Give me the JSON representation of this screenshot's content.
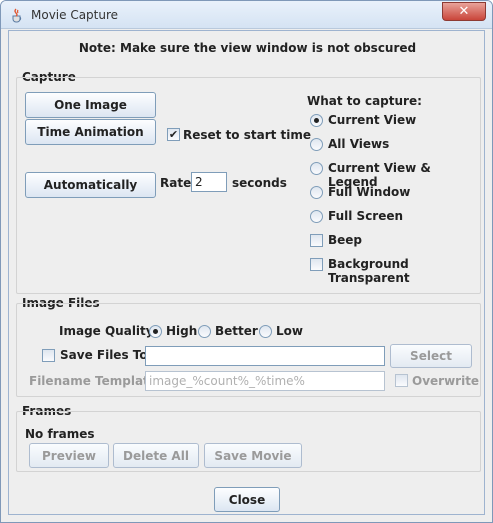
{
  "window": {
    "title": "Movie Capture",
    "close_glyph": "✕"
  },
  "note": "Note: Make sure the view window is not obscured",
  "capture": {
    "group_label": "Capture",
    "one_image": "One Image",
    "time_animation": "Time Animation",
    "reset_label": "Reset to start time",
    "reset_checked": "✔",
    "automatically": "Automatically",
    "rate_label": "Rate:",
    "rate_value": "2",
    "seconds_label": "seconds",
    "what_label": "What to capture:",
    "options": [
      "Current View",
      "All Views",
      "Current View & Legend",
      "Full Window",
      "Full Screen"
    ],
    "selected": "Current View",
    "beep_label": "Beep",
    "bg_transparent_label": "Background Transparent"
  },
  "image_files": {
    "group_label": "Image Files",
    "quality_label": "Image Quality:",
    "quality_options": [
      "High",
      "Better",
      "Low"
    ],
    "quality_selected": "High",
    "save_files_label": "Save Files To:",
    "save_files_value": "",
    "select_label": "Select",
    "template_label": "Filename Template:",
    "template_value": "image_%count%_%time%",
    "overwrite_label": "Overwrite"
  },
  "frames": {
    "group_label": "Frames",
    "status": "No frames",
    "preview": "Preview",
    "delete_all": "Delete All",
    "save_movie": "Save Movie"
  },
  "footer": {
    "close_label": "Close"
  },
  "colors": {
    "accent": "#7f9db9",
    "title_close": "#c9453a"
  }
}
